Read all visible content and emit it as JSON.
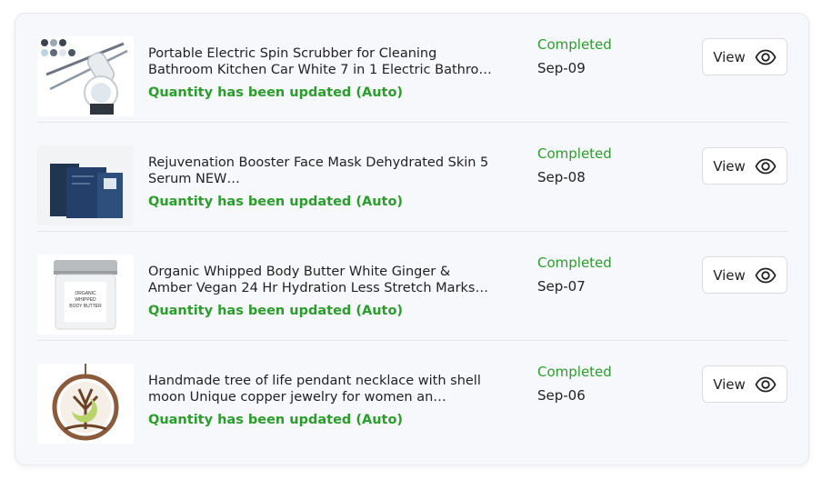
{
  "orders": [
    {
      "title": "Portable Electric Spin Scrubber for Cleaning Bathroom Kitchen Car White 7 in 1 Electric Bathro…",
      "quantity_note": "Quantity has been updated (Auto)",
      "status": "Completed",
      "date": "Sep-09",
      "view_label": "View",
      "thumb": "spin-scrubber",
      "view_icon": "eye-icon"
    },
    {
      "title": "Rejuvenation Booster Face Mask Dehydrated Skin 5 Serum NEW…",
      "quantity_note": "Quantity has been updated (Auto)",
      "status": "Completed",
      "date": "Sep-08",
      "view_label": "View",
      "thumb": "face-mask-box",
      "view_icon": "eye-icon"
    },
    {
      "title": "Organic Whipped Body Butter White Ginger & Amber Vegan 24 Hr Hydration Less Stretch Marks…",
      "quantity_note": "Quantity has been updated (Auto)",
      "status": "Completed",
      "date": "Sep-07",
      "view_label": "View",
      "thumb": "body-butter-jar",
      "product_label_lines": [
        "ORGANIC",
        "WHIPPED",
        "BODY BUTTER"
      ],
      "view_icon": "eye-icon"
    },
    {
      "title": "Handmade tree of life pendant necklace with shell moon Unique copper jewelry for women an…",
      "quantity_note": "Quantity has been updated (Auto)",
      "status": "Completed",
      "date": "Sep-06",
      "view_label": "View",
      "thumb": "tree-of-life-pendant",
      "view_icon": "eye-icon"
    }
  ],
  "colors": {
    "status_green": "#2a9d2a",
    "text_dark": "#222222",
    "card_bg": "#f7f8fc",
    "border": "#e3e5eb"
  }
}
